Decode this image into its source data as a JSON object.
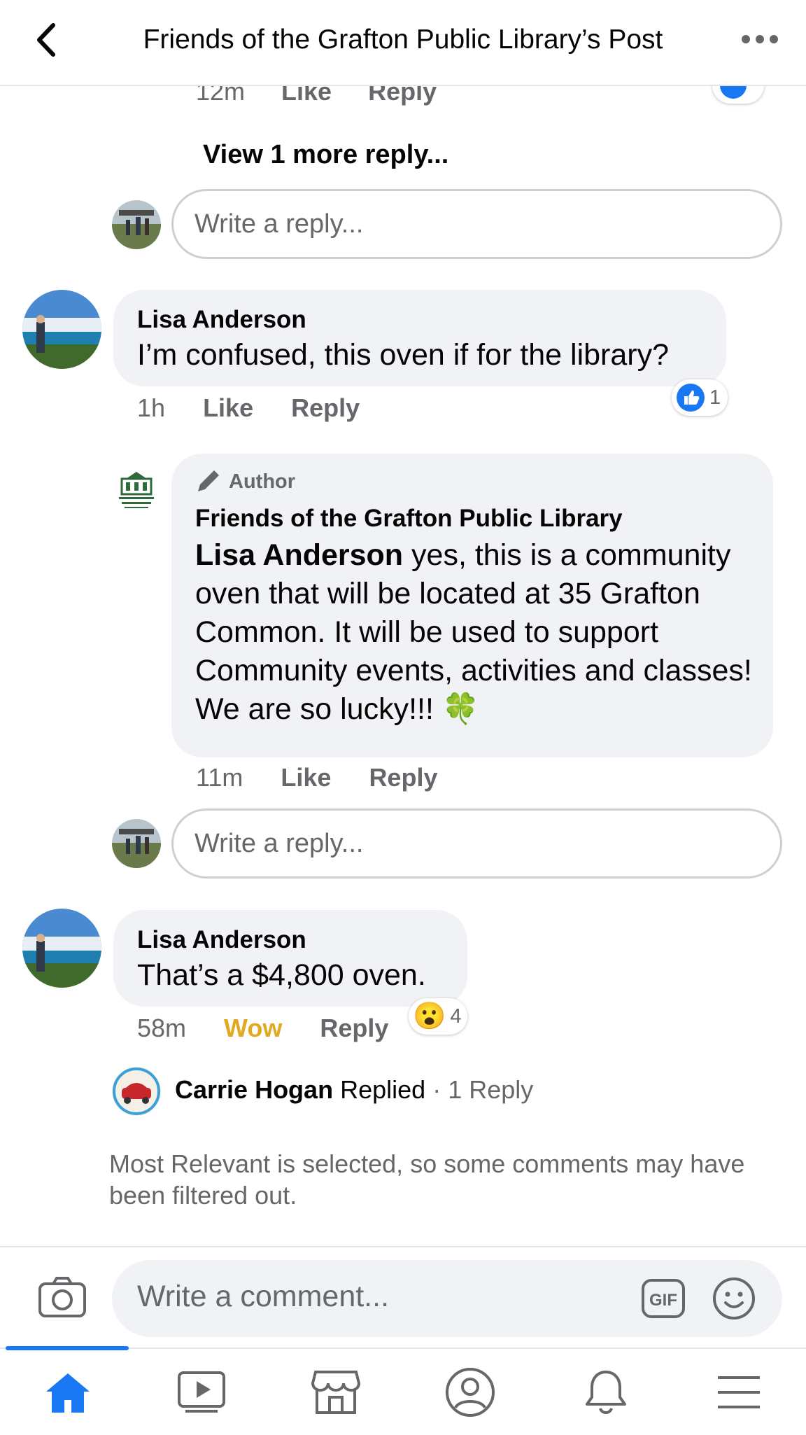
{
  "header": {
    "title": "Friends of the Grafton Public Library’s Post"
  },
  "top_partial_comment": {
    "time": "12m",
    "like": "Like",
    "reply": "Reply"
  },
  "view_more_replies": "View 1 more reply...",
  "reply_box_1": {
    "placeholder": "Write a reply..."
  },
  "comment_1": {
    "author": "Lisa Anderson",
    "text": "I’m confused, this oven if for the library?",
    "time": "1h",
    "like": "Like",
    "reply": "Reply",
    "reaction_icon": "like-icon",
    "reaction_count": "1"
  },
  "reply_1": {
    "badge": "Author",
    "author": "Friends of the Grafton Public Library",
    "mention": "Lisa Anderson",
    "text": " yes, this is a community oven that will be located at 35 Grafton Common. It will be used to support Community events, activities and classes! We are so lucky!!! ",
    "emoji": "🍀",
    "time": "11m",
    "like": "Like",
    "reply": "Reply"
  },
  "reply_box_2": {
    "placeholder": "Write a reply..."
  },
  "comment_2": {
    "author": "Lisa Anderson",
    "text": "That’s a $4,800 oven.",
    "time": "58m",
    "like": "Wow",
    "reply": "Reply",
    "reaction_emoji": "😮",
    "reaction_count": "4"
  },
  "replied_summary": {
    "name": "Carrie Hogan",
    "action": "Replied",
    "separator": "·",
    "count": "1 Reply"
  },
  "filter_note": "Most Relevant is selected, so some comments may have been filtered out.",
  "composer": {
    "placeholder": "Write a comment..."
  },
  "tabs": [
    {
      "icon": "home-icon",
      "active": true
    },
    {
      "icon": "video-icon",
      "active": false
    },
    {
      "icon": "marketplace-icon",
      "active": false
    },
    {
      "icon": "profile-icon",
      "active": false
    },
    {
      "icon": "bell-icon",
      "active": false
    },
    {
      "icon": "menu-icon",
      "active": false
    }
  ],
  "colors": {
    "accent": "#1877f2",
    "wow": "#e2a81e",
    "bubble": "#f0f2f5",
    "meta": "#65676b"
  }
}
